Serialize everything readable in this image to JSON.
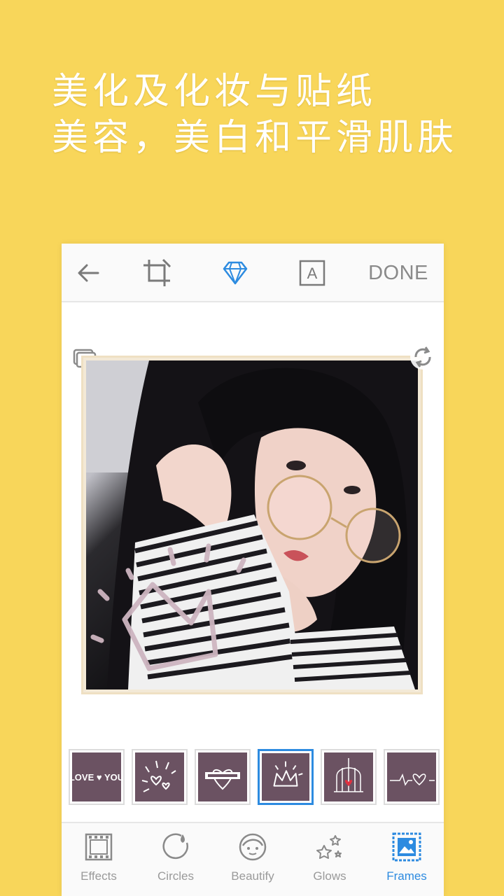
{
  "headline": {
    "line1": "美化及化妆与贴纸",
    "line2": "美容，美白和平滑肌肤"
  },
  "toolbar": {
    "done_label": "DONE",
    "text_tool_glyph": "A",
    "icons": [
      "back-arrow-icon",
      "crop-icon",
      "diamond-icon",
      "text-icon"
    ]
  },
  "frames": {
    "items": [
      {
        "name": "love-you",
        "text": "LOVE ♥ YOU"
      },
      {
        "name": "doodle-hearts"
      },
      {
        "name": "heart-banner"
      },
      {
        "name": "crown",
        "selected": true
      },
      {
        "name": "bird-cage"
      },
      {
        "name": "heartbeat"
      }
    ]
  },
  "bottom_nav": {
    "items": [
      {
        "label": "Effects",
        "icon": "film-icon"
      },
      {
        "label": "Circles",
        "icon": "circle-drop-icon"
      },
      {
        "label": "Beautify",
        "icon": "face-icon"
      },
      {
        "label": "Glows",
        "icon": "stars-icon"
      },
      {
        "label": "Frames",
        "icon": "frame-icon",
        "active": true
      }
    ]
  },
  "colors": {
    "background": "#F8D65A",
    "accent": "#2D8BE0",
    "frame_thumb_bg": "#6B5262",
    "text_gray": "#8A8A8A"
  }
}
